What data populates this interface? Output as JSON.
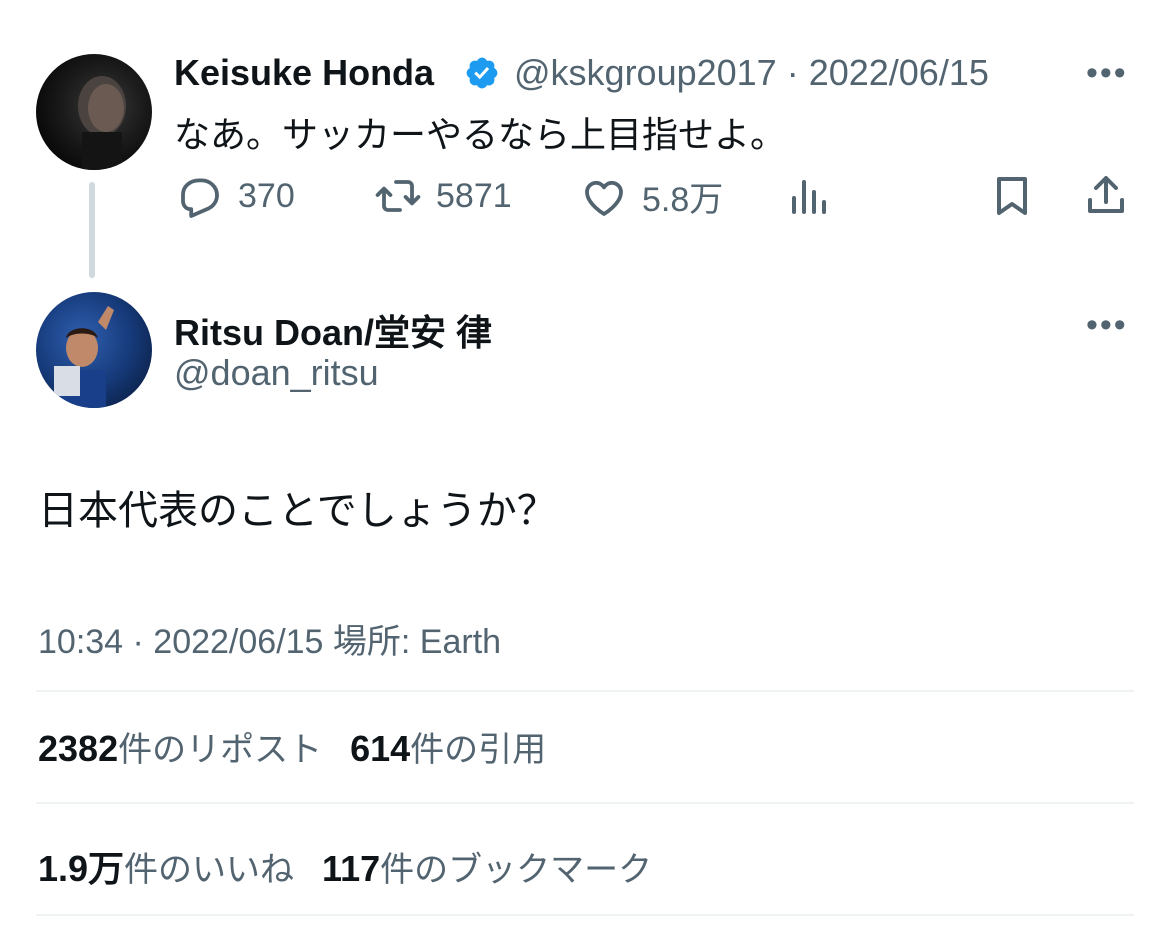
{
  "parent_tweet": {
    "author_name": "Keisuke Honda",
    "author_handle": "@kskgroup2017 · 2022/06/15",
    "text": "なあ。サッカーやるなら上目指せよ。",
    "more": "•••",
    "actions": {
      "reply_count": "370",
      "retweet_count": "5871",
      "like_count": "5.8万"
    }
  },
  "reply_tweet": {
    "author_name": "Ritsu Doan/堂安 律",
    "author_handle": "@doan_ritsu",
    "text": "日本代表のことでしょうか？",
    "more": "•••",
    "timestamp": "10:34 · 2022/06/15 場所: Earth"
  },
  "stats": {
    "reposts_count": "2382",
    "reposts_label": "件のリポスト",
    "quotes_count": "614",
    "quotes_label": "件の引用",
    "likes_count": "1.9万",
    "likes_label": "件のいいね",
    "bookmarks_count": "117",
    "bookmarks_label": "件のブックマーク"
  },
  "colors": {
    "text_primary": "#0f1419",
    "text_secondary": "#536471",
    "verified_blue": "#1d9bf0",
    "divider": "#eff3f4"
  },
  "icons": [
    "reply-icon",
    "retweet-icon",
    "like-icon",
    "views-icon",
    "bookmark-icon",
    "share-icon",
    "verified-badge-icon",
    "more-icon"
  ]
}
